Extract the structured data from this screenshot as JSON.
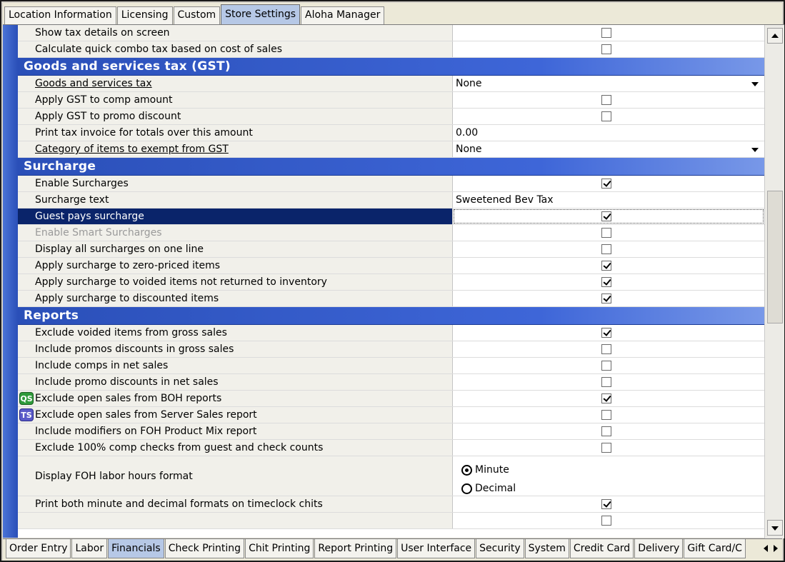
{
  "top_tabs": [
    {
      "label": "Location Information",
      "active": false
    },
    {
      "label": "Licensing",
      "active": false
    },
    {
      "label": "Custom",
      "active": false
    },
    {
      "label": "Store Settings",
      "active": true
    },
    {
      "label": "Aloha Manager",
      "active": false
    }
  ],
  "rows": {
    "tax1": {
      "label": "Show tax details on screen",
      "checked": false
    },
    "tax2": {
      "label": "Calculate quick combo tax based on cost of sales",
      "checked": false
    },
    "gst_header": {
      "title": "Goods and services tax (GST)",
      "toggle": "−"
    },
    "gst1": {
      "label": "Goods and services tax",
      "value": "None"
    },
    "gst2": {
      "label": "Apply GST to comp amount",
      "checked": false
    },
    "gst3": {
      "label": "Apply GST to promo discount",
      "checked": false
    },
    "gst4": {
      "label": "Print tax invoice for totals over this amount",
      "value": "0.00"
    },
    "gst5": {
      "label": "Category of items to exempt from GST",
      "value": "None"
    },
    "sur_header": {
      "title": "Surcharge",
      "toggle": "−"
    },
    "sur1": {
      "label": "Enable Surcharges",
      "checked": true
    },
    "sur2": {
      "label": "Surcharge text",
      "value": "Sweetened Bev Tax"
    },
    "sur3": {
      "label": "Guest pays surcharge",
      "checked": true
    },
    "sur4": {
      "label": "Enable Smart Surcharges",
      "checked": false
    },
    "sur5": {
      "label": "Display all surcharges on one line",
      "checked": false
    },
    "sur6": {
      "label": "Apply surcharge to zero-priced items",
      "checked": true
    },
    "sur7": {
      "label": "Apply surcharge to voided items not returned to inventory",
      "checked": true
    },
    "sur8": {
      "label": "Apply surcharge to discounted items",
      "checked": true
    },
    "rep_header": {
      "title": "Reports",
      "toggle": "−"
    },
    "rep1": {
      "label": "Exclude voided items from gross sales",
      "checked": true
    },
    "rep2": {
      "label": "Include promos discounts in gross sales",
      "checked": false
    },
    "rep3": {
      "label": "Include comps in net sales",
      "checked": false
    },
    "rep4": {
      "label": "Include promo discounts in net sales",
      "checked": false
    },
    "rep5": {
      "label": "Exclude open sales from BOH reports",
      "badge": "QS",
      "checked": true
    },
    "rep6": {
      "label": "Exclude open sales from Server Sales report",
      "badge": "TS",
      "checked": false
    },
    "rep7": {
      "label": "Include modifiers on FOH Product Mix report",
      "checked": false
    },
    "rep8": {
      "label": "Exclude 100% comp checks from guest and check counts",
      "checked": false
    },
    "rep9": {
      "label": "Display FOH labor hours format",
      "options": [
        "Minute",
        "Decimal"
      ],
      "selected": "Minute"
    },
    "rep10": {
      "label": "Print both minute and decimal formats on timeclock chits",
      "checked": true
    }
  },
  "bottom_tabs": [
    {
      "label": "Order Entry",
      "active": false
    },
    {
      "label": "Labor",
      "active": false
    },
    {
      "label": "Financials",
      "active": true
    },
    {
      "label": "Check Printing",
      "active": false
    },
    {
      "label": "Chit Printing",
      "active": false
    },
    {
      "label": "Report Printing",
      "active": false
    },
    {
      "label": "User Interface",
      "active": false
    },
    {
      "label": "Security",
      "active": false
    },
    {
      "label": "System",
      "active": false
    },
    {
      "label": "Credit Card",
      "active": false
    },
    {
      "label": "Delivery",
      "active": false
    },
    {
      "label": "Gift Card/C",
      "active": false
    }
  ],
  "colors": {
    "section_bg": "#2a4fb8",
    "selected_row": "#0a246a",
    "active_tab": "#b6c8e6"
  }
}
